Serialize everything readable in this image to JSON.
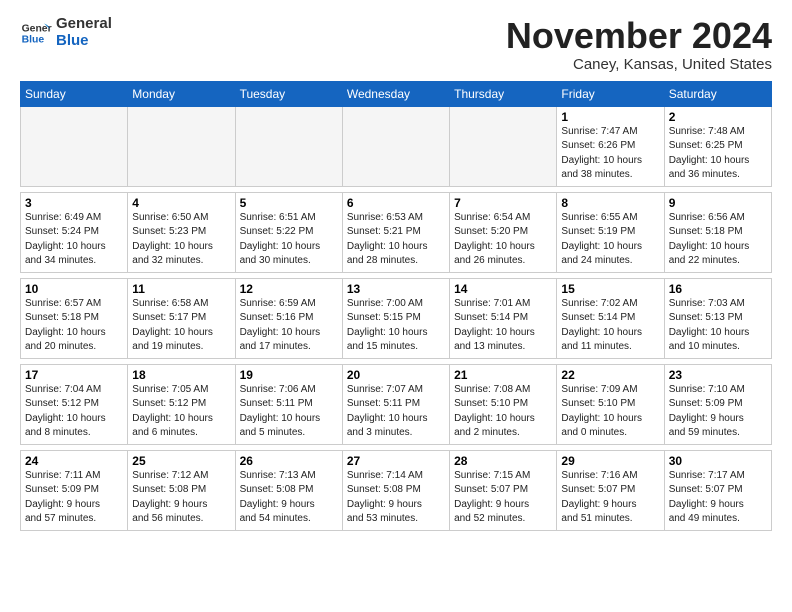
{
  "logo": {
    "line1": "General",
    "line2": "Blue"
  },
  "title": "November 2024",
  "location": "Caney, Kansas, United States",
  "weekdays": [
    "Sunday",
    "Monday",
    "Tuesday",
    "Wednesday",
    "Thursday",
    "Friday",
    "Saturday"
  ],
  "weeks": [
    [
      {
        "day": "",
        "info": ""
      },
      {
        "day": "",
        "info": ""
      },
      {
        "day": "",
        "info": ""
      },
      {
        "day": "",
        "info": ""
      },
      {
        "day": "",
        "info": ""
      },
      {
        "day": "1",
        "info": "Sunrise: 7:47 AM\nSunset: 6:26 PM\nDaylight: 10 hours\nand 38 minutes."
      },
      {
        "day": "2",
        "info": "Sunrise: 7:48 AM\nSunset: 6:25 PM\nDaylight: 10 hours\nand 36 minutes."
      }
    ],
    [
      {
        "day": "3",
        "info": "Sunrise: 6:49 AM\nSunset: 5:24 PM\nDaylight: 10 hours\nand 34 minutes."
      },
      {
        "day": "4",
        "info": "Sunrise: 6:50 AM\nSunset: 5:23 PM\nDaylight: 10 hours\nand 32 minutes."
      },
      {
        "day": "5",
        "info": "Sunrise: 6:51 AM\nSunset: 5:22 PM\nDaylight: 10 hours\nand 30 minutes."
      },
      {
        "day": "6",
        "info": "Sunrise: 6:53 AM\nSunset: 5:21 PM\nDaylight: 10 hours\nand 28 minutes."
      },
      {
        "day": "7",
        "info": "Sunrise: 6:54 AM\nSunset: 5:20 PM\nDaylight: 10 hours\nand 26 minutes."
      },
      {
        "day": "8",
        "info": "Sunrise: 6:55 AM\nSunset: 5:19 PM\nDaylight: 10 hours\nand 24 minutes."
      },
      {
        "day": "9",
        "info": "Sunrise: 6:56 AM\nSunset: 5:18 PM\nDaylight: 10 hours\nand 22 minutes."
      }
    ],
    [
      {
        "day": "10",
        "info": "Sunrise: 6:57 AM\nSunset: 5:18 PM\nDaylight: 10 hours\nand 20 minutes."
      },
      {
        "day": "11",
        "info": "Sunrise: 6:58 AM\nSunset: 5:17 PM\nDaylight: 10 hours\nand 19 minutes."
      },
      {
        "day": "12",
        "info": "Sunrise: 6:59 AM\nSunset: 5:16 PM\nDaylight: 10 hours\nand 17 minutes."
      },
      {
        "day": "13",
        "info": "Sunrise: 7:00 AM\nSunset: 5:15 PM\nDaylight: 10 hours\nand 15 minutes."
      },
      {
        "day": "14",
        "info": "Sunrise: 7:01 AM\nSunset: 5:14 PM\nDaylight: 10 hours\nand 13 minutes."
      },
      {
        "day": "15",
        "info": "Sunrise: 7:02 AM\nSunset: 5:14 PM\nDaylight: 10 hours\nand 11 minutes."
      },
      {
        "day": "16",
        "info": "Sunrise: 7:03 AM\nSunset: 5:13 PM\nDaylight: 10 hours\nand 10 minutes."
      }
    ],
    [
      {
        "day": "17",
        "info": "Sunrise: 7:04 AM\nSunset: 5:12 PM\nDaylight: 10 hours\nand 8 minutes."
      },
      {
        "day": "18",
        "info": "Sunrise: 7:05 AM\nSunset: 5:12 PM\nDaylight: 10 hours\nand 6 minutes."
      },
      {
        "day": "19",
        "info": "Sunrise: 7:06 AM\nSunset: 5:11 PM\nDaylight: 10 hours\nand 5 minutes."
      },
      {
        "day": "20",
        "info": "Sunrise: 7:07 AM\nSunset: 5:11 PM\nDaylight: 10 hours\nand 3 minutes."
      },
      {
        "day": "21",
        "info": "Sunrise: 7:08 AM\nSunset: 5:10 PM\nDaylight: 10 hours\nand 2 minutes."
      },
      {
        "day": "22",
        "info": "Sunrise: 7:09 AM\nSunset: 5:10 PM\nDaylight: 10 hours\nand 0 minutes."
      },
      {
        "day": "23",
        "info": "Sunrise: 7:10 AM\nSunset: 5:09 PM\nDaylight: 9 hours\nand 59 minutes."
      }
    ],
    [
      {
        "day": "24",
        "info": "Sunrise: 7:11 AM\nSunset: 5:09 PM\nDaylight: 9 hours\nand 57 minutes."
      },
      {
        "day": "25",
        "info": "Sunrise: 7:12 AM\nSunset: 5:08 PM\nDaylight: 9 hours\nand 56 minutes."
      },
      {
        "day": "26",
        "info": "Sunrise: 7:13 AM\nSunset: 5:08 PM\nDaylight: 9 hours\nand 54 minutes."
      },
      {
        "day": "27",
        "info": "Sunrise: 7:14 AM\nSunset: 5:08 PM\nDaylight: 9 hours\nand 53 minutes."
      },
      {
        "day": "28",
        "info": "Sunrise: 7:15 AM\nSunset: 5:07 PM\nDaylight: 9 hours\nand 52 minutes."
      },
      {
        "day": "29",
        "info": "Sunrise: 7:16 AM\nSunset: 5:07 PM\nDaylight: 9 hours\nand 51 minutes."
      },
      {
        "day": "30",
        "info": "Sunrise: 7:17 AM\nSunset: 5:07 PM\nDaylight: 9 hours\nand 49 minutes."
      }
    ]
  ]
}
